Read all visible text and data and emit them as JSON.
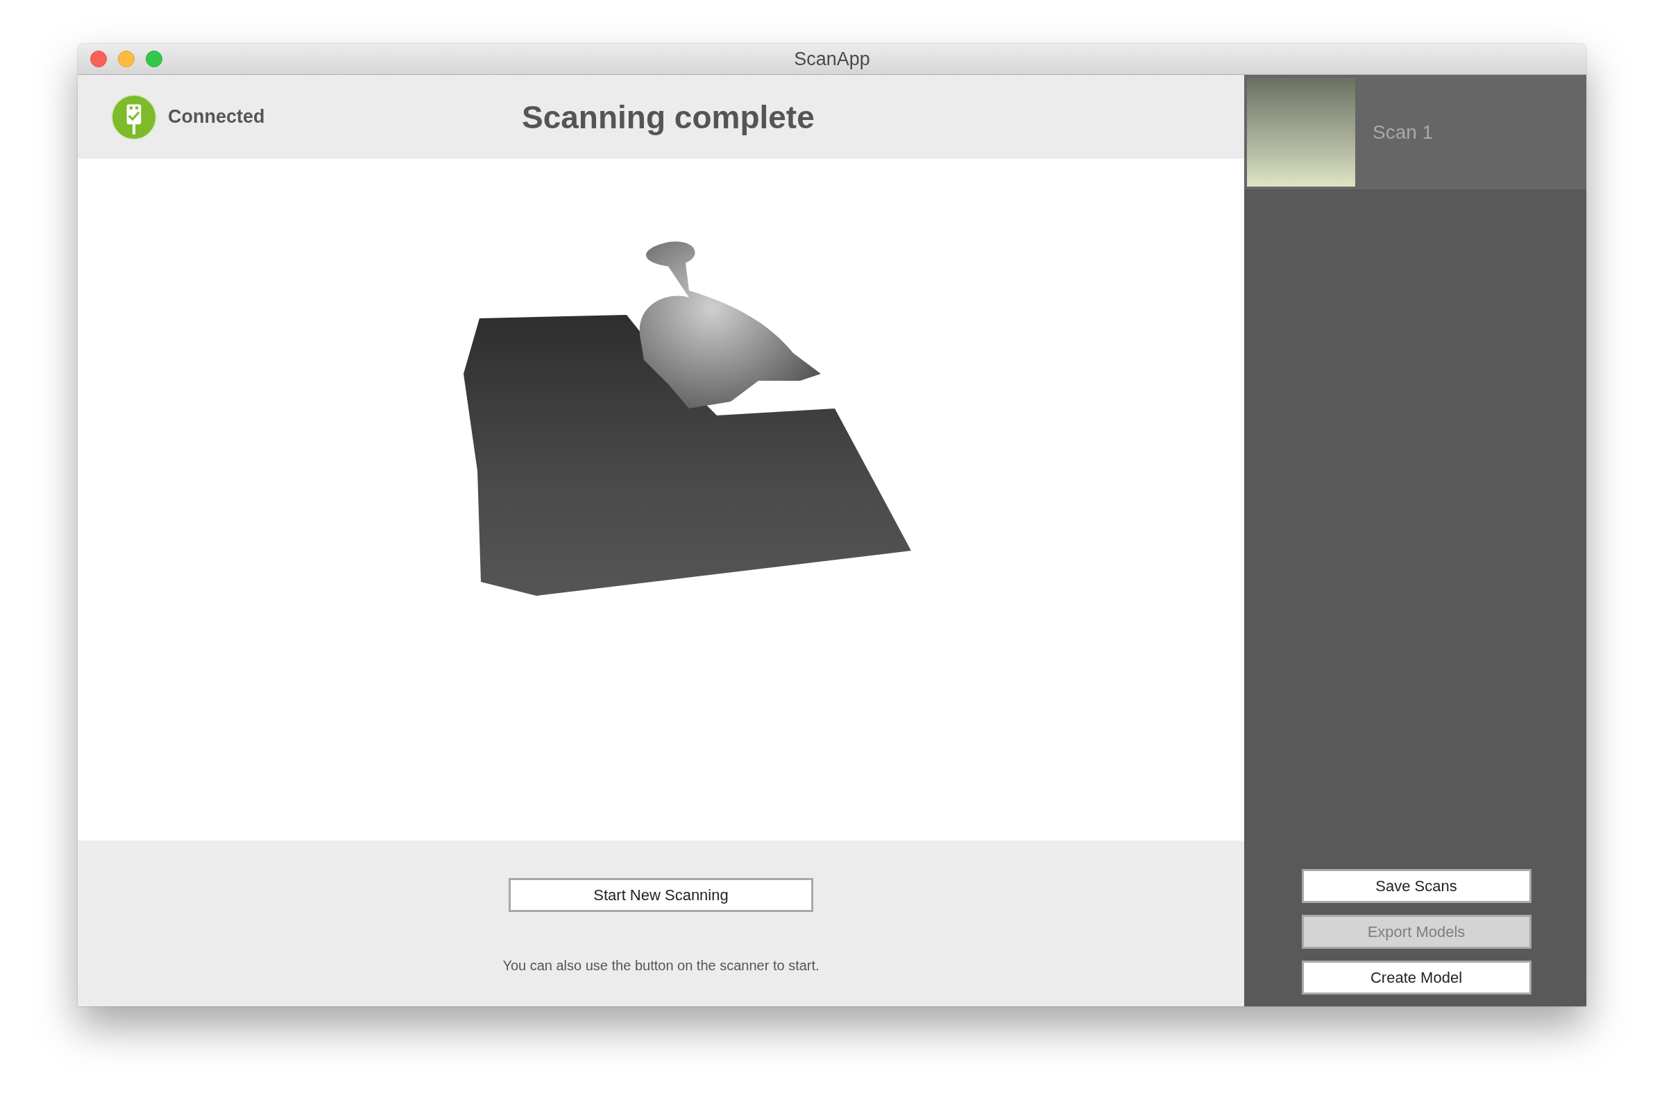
{
  "window": {
    "title": "ScanApp"
  },
  "status": {
    "label": "Connected",
    "connected": true
  },
  "heading": "Scanning complete",
  "start_button": {
    "label": "Start New Scanning"
  },
  "hint": "You can also use the button on the scanner to start.",
  "scans": [
    {
      "name": "Scan 1"
    }
  ],
  "sidebar_buttons": [
    {
      "label": "Save Scans",
      "disabled": false
    },
    {
      "label": "Export Models",
      "disabled": true
    },
    {
      "label": "Create Model",
      "disabled": false
    }
  ]
}
